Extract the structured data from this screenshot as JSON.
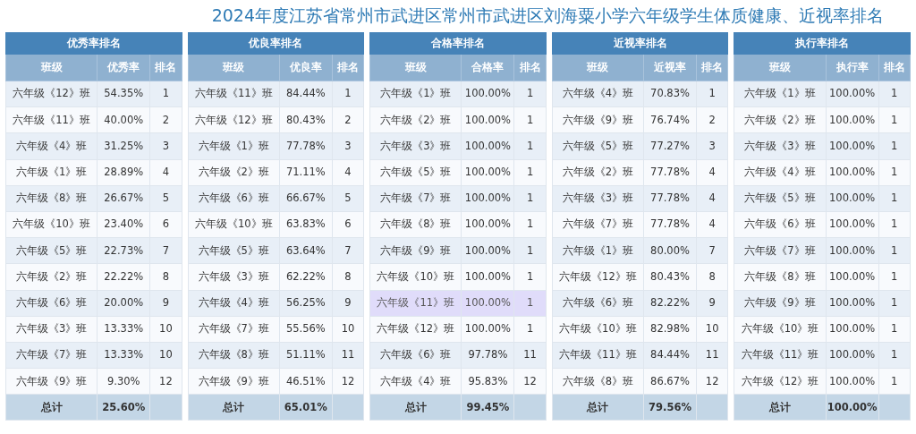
{
  "title": "2024年度江苏省常州市武进区常州市武进区刘海粟小学六年级学生体质健康、近视率排名",
  "panels": [
    {
      "title": "优秀率排名",
      "columns": [
        "班级",
        "优秀率",
        "排名"
      ],
      "rows": [
        {
          "class": "六年级《12》班",
          "rate": "54.35%",
          "rank": "1",
          "selected": false
        },
        {
          "class": "六年级《11》班",
          "rate": "40.00%",
          "rank": "2",
          "selected": false
        },
        {
          "class": "六年级《4》班",
          "rate": "31.25%",
          "rank": "3",
          "selected": false
        },
        {
          "class": "六年级《1》班",
          "rate": "28.89%",
          "rank": "4",
          "selected": false
        },
        {
          "class": "六年级《8》班",
          "rate": "26.67%",
          "rank": "5",
          "selected": false
        },
        {
          "class": "六年级《10》班",
          "rate": "23.40%",
          "rank": "6",
          "selected": false
        },
        {
          "class": "六年级《5》班",
          "rate": "22.73%",
          "rank": "7",
          "selected": false
        },
        {
          "class": "六年级《2》班",
          "rate": "22.22%",
          "rank": "8",
          "selected": false
        },
        {
          "class": "六年级《6》班",
          "rate": "20.00%",
          "rank": "9",
          "selected": false
        },
        {
          "class": "六年级《3》班",
          "rate": "13.33%",
          "rank": "10",
          "selected": false
        },
        {
          "class": "六年级《7》班",
          "rate": "13.33%",
          "rank": "10",
          "selected": false
        },
        {
          "class": "六年级《9》班",
          "rate": "9.30%",
          "rank": "12",
          "selected": false
        }
      ],
      "total": {
        "label": "总计",
        "value": "25.60%"
      }
    },
    {
      "title": "优良率排名",
      "columns": [
        "班级",
        "优良率",
        "排名"
      ],
      "rows": [
        {
          "class": "六年级《11》班",
          "rate": "84.44%",
          "rank": "1",
          "selected": false
        },
        {
          "class": "六年级《12》班",
          "rate": "80.43%",
          "rank": "2",
          "selected": false
        },
        {
          "class": "六年级《1》班",
          "rate": "77.78%",
          "rank": "3",
          "selected": false
        },
        {
          "class": "六年级《2》班",
          "rate": "71.11%",
          "rank": "4",
          "selected": false
        },
        {
          "class": "六年级《6》班",
          "rate": "66.67%",
          "rank": "5",
          "selected": false
        },
        {
          "class": "六年级《10》班",
          "rate": "63.83%",
          "rank": "6",
          "selected": false
        },
        {
          "class": "六年级《5》班",
          "rate": "63.64%",
          "rank": "7",
          "selected": false
        },
        {
          "class": "六年级《3》班",
          "rate": "62.22%",
          "rank": "8",
          "selected": false
        },
        {
          "class": "六年级《4》班",
          "rate": "56.25%",
          "rank": "9",
          "selected": false
        },
        {
          "class": "六年级《7》班",
          "rate": "55.56%",
          "rank": "10",
          "selected": false
        },
        {
          "class": "六年级《8》班",
          "rate": "51.11%",
          "rank": "11",
          "selected": false
        },
        {
          "class": "六年级《9》班",
          "rate": "46.51%",
          "rank": "12",
          "selected": false
        }
      ],
      "total": {
        "label": "总计",
        "value": "65.01%"
      }
    },
    {
      "title": "合格率排名",
      "columns": [
        "班级",
        "合格率",
        "排名"
      ],
      "rows": [
        {
          "class": "六年级《1》班",
          "rate": "100.00%",
          "rank": "1",
          "selected": false
        },
        {
          "class": "六年级《2》班",
          "rate": "100.00%",
          "rank": "1",
          "selected": false
        },
        {
          "class": "六年级《3》班",
          "rate": "100.00%",
          "rank": "1",
          "selected": false
        },
        {
          "class": "六年级《5》班",
          "rate": "100.00%",
          "rank": "1",
          "selected": false
        },
        {
          "class": "六年级《7》班",
          "rate": "100.00%",
          "rank": "1",
          "selected": false
        },
        {
          "class": "六年级《8》班",
          "rate": "100.00%",
          "rank": "1",
          "selected": false
        },
        {
          "class": "六年级《9》班",
          "rate": "100.00%",
          "rank": "1",
          "selected": false
        },
        {
          "class": "六年级《10》班",
          "rate": "100.00%",
          "rank": "1",
          "selected": false
        },
        {
          "class": "六年级《11》班",
          "rate": "100.00%",
          "rank": "1",
          "selected": true
        },
        {
          "class": "六年级《12》班",
          "rate": "100.00%",
          "rank": "1",
          "selected": false
        },
        {
          "class": "六年级《6》班",
          "rate": "97.78%",
          "rank": "11",
          "selected": false
        },
        {
          "class": "六年级《4》班",
          "rate": "95.83%",
          "rank": "12",
          "selected": false
        }
      ],
      "total": {
        "label": "总计",
        "value": "99.45%"
      }
    },
    {
      "title": "近视率排名",
      "columns": [
        "班级",
        "近视率",
        "排名"
      ],
      "rows": [
        {
          "class": "六年级《4》班",
          "rate": "70.83%",
          "rank": "1",
          "selected": false
        },
        {
          "class": "六年级《9》班",
          "rate": "76.74%",
          "rank": "2",
          "selected": false
        },
        {
          "class": "六年级《5》班",
          "rate": "77.27%",
          "rank": "3",
          "selected": false
        },
        {
          "class": "六年级《2》班",
          "rate": "77.78%",
          "rank": "4",
          "selected": false
        },
        {
          "class": "六年级《3》班",
          "rate": "77.78%",
          "rank": "4",
          "selected": false
        },
        {
          "class": "六年级《7》班",
          "rate": "77.78%",
          "rank": "4",
          "selected": false
        },
        {
          "class": "六年级《1》班",
          "rate": "80.00%",
          "rank": "7",
          "selected": false
        },
        {
          "class": "六年级《12》班",
          "rate": "80.43%",
          "rank": "8",
          "selected": false
        },
        {
          "class": "六年级《6》班",
          "rate": "82.22%",
          "rank": "9",
          "selected": false
        },
        {
          "class": "六年级《10》班",
          "rate": "82.98%",
          "rank": "10",
          "selected": false
        },
        {
          "class": "六年级《11》班",
          "rate": "84.44%",
          "rank": "11",
          "selected": false
        },
        {
          "class": "六年级《8》班",
          "rate": "86.67%",
          "rank": "12",
          "selected": false
        }
      ],
      "total": {
        "label": "总计",
        "value": "79.56%"
      }
    },
    {
      "title": "执行率排名",
      "columns": [
        "班级",
        "执行率",
        "排名"
      ],
      "rows": [
        {
          "class": "六年级《1》班",
          "rate": "100.00%",
          "rank": "1",
          "selected": false
        },
        {
          "class": "六年级《2》班",
          "rate": "100.00%",
          "rank": "1",
          "selected": false
        },
        {
          "class": "六年级《3》班",
          "rate": "100.00%",
          "rank": "1",
          "selected": false
        },
        {
          "class": "六年级《4》班",
          "rate": "100.00%",
          "rank": "1",
          "selected": false
        },
        {
          "class": "六年级《5》班",
          "rate": "100.00%",
          "rank": "1",
          "selected": false
        },
        {
          "class": "六年级《6》班",
          "rate": "100.00%",
          "rank": "1",
          "selected": false
        },
        {
          "class": "六年级《7》班",
          "rate": "100.00%",
          "rank": "1",
          "selected": false
        },
        {
          "class": "六年级《8》班",
          "rate": "100.00%",
          "rank": "1",
          "selected": false
        },
        {
          "class": "六年级《9》班",
          "rate": "100.00%",
          "rank": "1",
          "selected": false
        },
        {
          "class": "六年级《10》班",
          "rate": "100.00%",
          "rank": "1",
          "selected": false
        },
        {
          "class": "六年级《11》班",
          "rate": "100.00%",
          "rank": "1",
          "selected": false
        },
        {
          "class": "六年级《12》班",
          "rate": "100.00%",
          "rank": "1",
          "selected": false
        }
      ],
      "total": {
        "label": "总计",
        "value": "100.00%"
      }
    }
  ]
}
